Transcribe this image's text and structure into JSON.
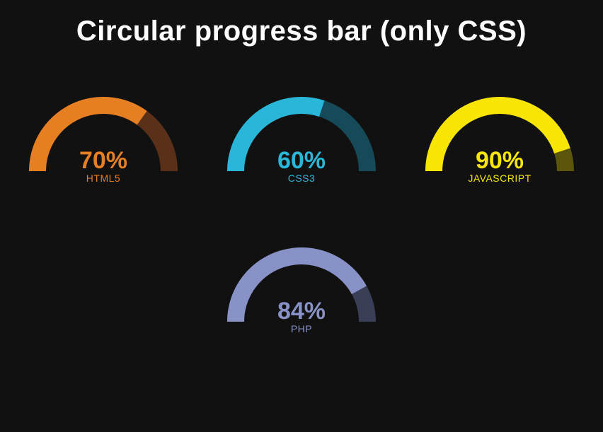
{
  "title": "Circular progress bar (only CSS)",
  "gauges": [
    {
      "percent": 70,
      "percent_text": "70%",
      "label": "HTML5",
      "color": "#e67e22",
      "track": "#5a3118"
    },
    {
      "percent": 60,
      "percent_text": "60%",
      "label": "CSS3",
      "color": "#29b6d8",
      "track": "#164a58"
    },
    {
      "percent": 90,
      "percent_text": "90%",
      "label": "JAVASCRIPT",
      "color": "#f8e504",
      "track": "#5c560d"
    },
    {
      "percent": 84,
      "percent_text": "84%",
      "label": "PHP",
      "color": "#8892c6",
      "track": "#3a3e57"
    }
  ],
  "chart_data": [
    {
      "type": "bar",
      "title": "HTML5",
      "categories": [
        "HTML5"
      ],
      "values": [
        70
      ],
      "xlabel": "",
      "ylabel": "%",
      "ylim": [
        0,
        100
      ]
    },
    {
      "type": "bar",
      "title": "CSS3",
      "categories": [
        "CSS3"
      ],
      "values": [
        60
      ],
      "xlabel": "",
      "ylabel": "%",
      "ylim": [
        0,
        100
      ]
    },
    {
      "type": "bar",
      "title": "JAVASCRIPT",
      "categories": [
        "JAVASCRIPT"
      ],
      "values": [
        90
      ],
      "xlabel": "",
      "ylabel": "%",
      "ylim": [
        0,
        100
      ]
    },
    {
      "type": "bar",
      "title": "PHP",
      "categories": [
        "PHP"
      ],
      "values": [
        84
      ],
      "xlabel": "",
      "ylabel": "%",
      "ylim": [
        0,
        100
      ]
    }
  ]
}
